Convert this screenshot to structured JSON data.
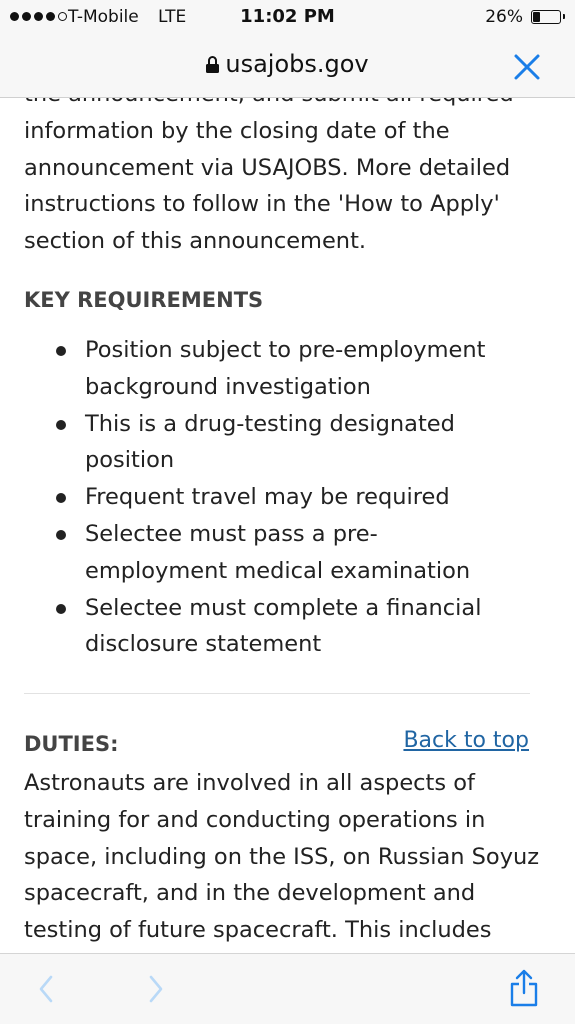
{
  "status_bar": {
    "carrier": "T-Mobile",
    "network": "LTE",
    "time": "11:02 PM",
    "battery_percent": "26%",
    "battery_level": 0.26,
    "signal_bars_filled": 4,
    "signal_bars_total": 5
  },
  "address_bar": {
    "url": "usajobs.gov",
    "lock_icon": "lock-icon",
    "close_icon": "close-icon"
  },
  "content": {
    "intro_partial_line": "the announcement, and submit all required",
    "intro_text": "information by the closing date of the announcement via USAJOBS. More detailed instructions to follow in the 'How to Apply' section of this announcement.",
    "key_requirements": {
      "heading": "KEY REQUIREMENTS",
      "items": [
        "Position subject to pre-employment background investigation",
        "This is a drug-testing designated position",
        "Frequent travel may be required",
        "Selectee must pass a pre-employment medical examination",
        "Selectee must complete a financial disclosure statement"
      ]
    },
    "duties": {
      "heading": "DUTIES:",
      "back_to_top": "Back to top",
      "text": "Astronauts are involved in all aspects of training for and conducting operations in space, including on the ISS, on Russian Soyuz spacecraft, and in the development and testing of future spacecraft. This includes"
    }
  },
  "toolbar": {
    "back_icon": "chevron-left-icon",
    "forward_icon": "chevron-right-icon",
    "share_icon": "share-icon"
  },
  "colors": {
    "link": "#2065a3",
    "toolbar_icon": "#1a7ee8",
    "toolbar_icon_disabled": "#b9d9f7",
    "heading": "#444444",
    "text": "#222222"
  }
}
